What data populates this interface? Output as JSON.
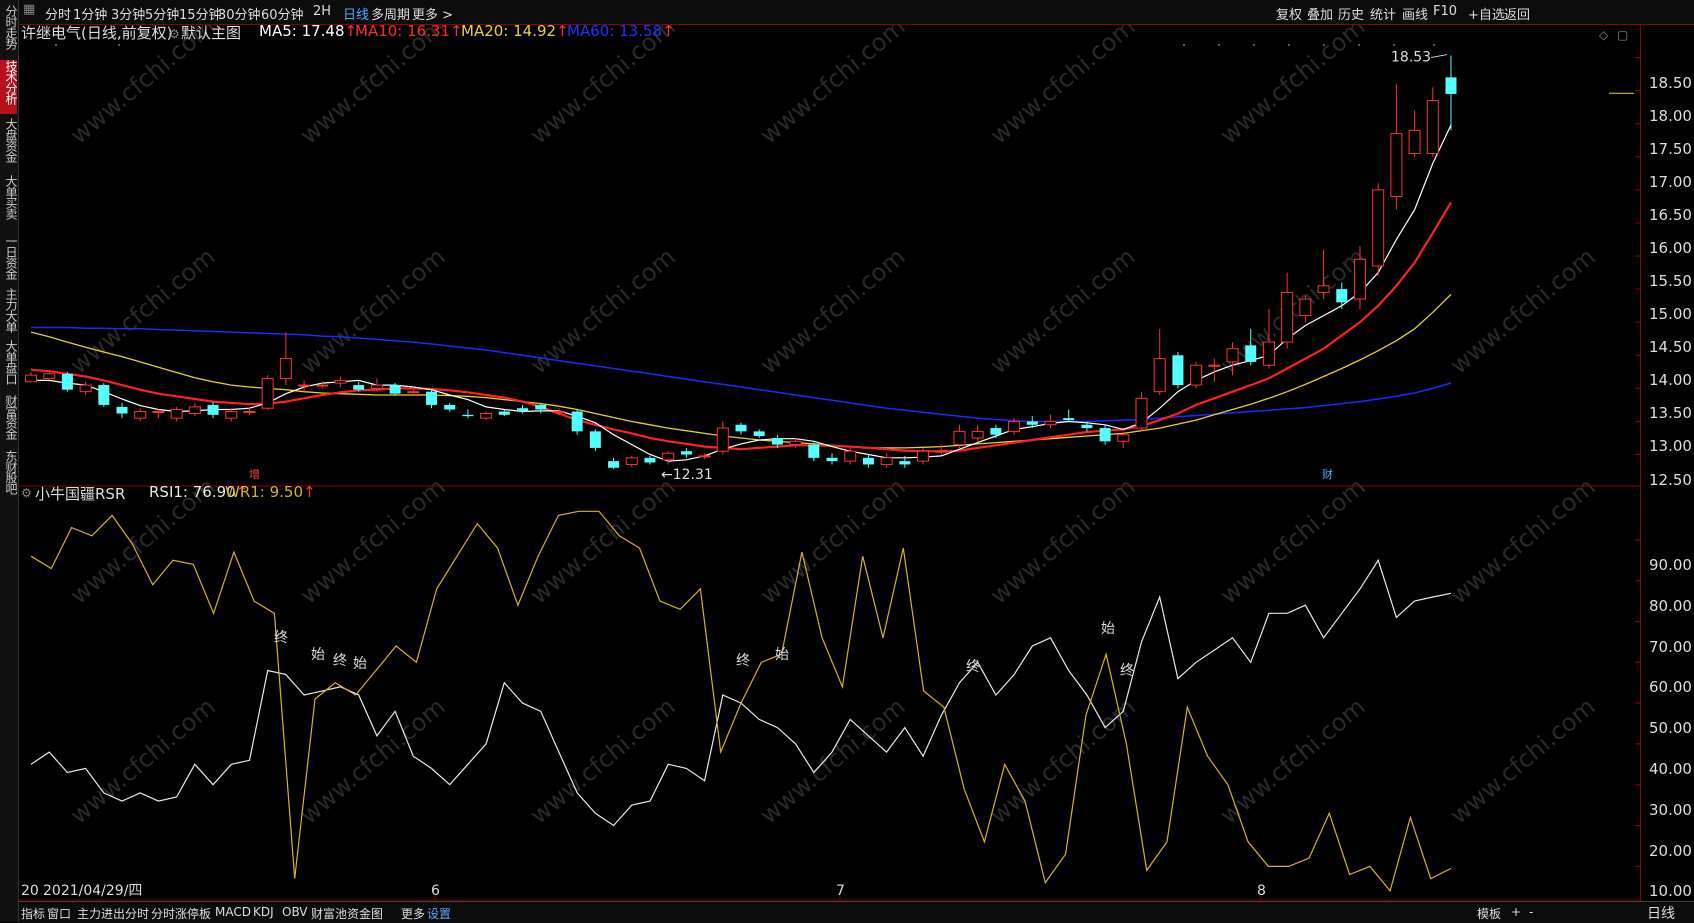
{
  "sidebar": [
    {
      "label": "分时走势",
      "active": false
    },
    {
      "label": "技术分析",
      "active": true
    },
    {
      "label": "大盘资金",
      "active": false
    },
    {
      "label": "大单买卖",
      "active": false
    },
    {
      "label": "一日资金",
      "active": false
    },
    {
      "label": "主力大单",
      "active": false
    },
    {
      "label": "大单盘口",
      "active": false
    },
    {
      "label": "财富资金",
      "active": false
    },
    {
      "label": "东财股吧",
      "active": false
    }
  ],
  "toolbar": {
    "periods": [
      "分时",
      "1分钟",
      "3分钟",
      "5分钟",
      "15分钟",
      "30分钟",
      "60分钟",
      "2H",
      "日线",
      "多周期",
      "更多 >"
    ],
    "active_period": "日线",
    "right_tools": [
      "复权",
      "叠加",
      "历史",
      "统计",
      "画线",
      "F10",
      "+自选",
      "返回"
    ]
  },
  "main_chart": {
    "stock_name": "许继电气(日线,前复权)",
    "template": "默认主图",
    "ma": [
      {
        "label": "MA5: 17.48",
        "color": "#ffffff"
      },
      {
        "label": "MA10: 16.31",
        "color": "#ff2a2a"
      },
      {
        "label": "MA20: 14.92",
        "color": "#e8d23a"
      },
      {
        "label": "MA60: 13.58",
        "color": "#1e32ff"
      }
    ],
    "high_mark": "18.53",
    "low_mark": "12.31",
    "y_ticks": [
      "18.50",
      "18.00",
      "17.50",
      "17.00",
      "16.50",
      "16.00",
      "15.50",
      "15.00",
      "14.50",
      "14.00",
      "13.50",
      "13.00",
      "12.50"
    ],
    "markers": [
      "增",
      "财"
    ]
  },
  "indicator": {
    "name": "小牛国疆RSR",
    "rsi": "RSI1: 76.90",
    "wr": "WR1: 9.50",
    "y_ticks": [
      "90.00",
      "80.00",
      "70.00",
      "60.00",
      "50.00",
      "40.00",
      "30.00",
      "20.00",
      "10.00"
    ],
    "labels": [
      "终",
      "始",
      "终",
      "始",
      "终",
      "始",
      "终",
      "始",
      "终"
    ]
  },
  "x_axis": {
    "date_label": "2021/04/29/四",
    "start_stub": "20",
    "months": [
      "6",
      "7",
      "8"
    ],
    "period": "日线"
  },
  "bottom_tabs": [
    "指标",
    "窗口",
    "主力进出分时",
    "分时涨停板",
    "MACD",
    "KDJ",
    "OBV",
    "财富池资金图",
    "更多",
    "设置"
  ],
  "bottom_right": [
    "模板",
    "+",
    "-"
  ],
  "watermark": "www.cfchi.com",
  "colors": {
    "up": "#ff3030",
    "down": "#54ffff",
    "ma5": "#ffffff",
    "ma10": "#ff2020",
    "ma20": "#e5cf2e",
    "ma60": "#1a2bff",
    "rsi": "#e8e8e8",
    "wr": "#d6b22a",
    "accent": "#5aa8ff"
  },
  "chart_data": [
    {
      "type": "candlestick",
      "title": "许继电气(日线,前复权)",
      "ylim": [
        12.1,
        18.75
      ],
      "candles": [
        [
          13.6,
          13.7,
          13.6,
          13.75
        ],
        [
          13.65,
          13.72,
          13.68,
          13.78
        ],
        [
          13.72,
          13.48,
          13.45,
          13.75
        ],
        [
          13.45,
          13.55,
          13.4,
          13.6
        ],
        [
          13.55,
          13.25,
          13.22,
          13.58
        ],
        [
          13.22,
          13.12,
          13.05,
          13.28
        ],
        [
          13.05,
          13.15,
          13.0,
          13.2
        ],
        [
          13.15,
          13.15,
          13.05,
          13.18
        ],
        [
          13.05,
          13.18,
          13.0,
          13.22
        ],
        [
          13.12,
          13.22,
          13.08,
          13.28
        ],
        [
          13.25,
          13.1,
          13.05,
          13.3
        ],
        [
          13.05,
          13.15,
          13.0,
          13.2
        ],
        [
          13.15,
          13.15,
          13.1,
          13.22
        ],
        [
          13.2,
          13.65,
          13.18,
          13.7
        ],
        [
          13.65,
          13.95,
          13.55,
          14.35
        ],
        [
          13.55,
          13.55,
          13.45,
          13.62
        ],
        [
          13.55,
          13.55,
          13.5,
          13.6
        ],
        [
          13.58,
          13.62,
          13.52,
          13.68
        ],
        [
          13.55,
          13.48,
          13.45,
          13.6
        ],
        [
          13.5,
          13.55,
          13.45,
          13.65
        ],
        [
          13.55,
          13.42,
          13.4,
          13.58
        ],
        [
          13.45,
          13.45,
          13.42,
          13.52
        ],
        [
          13.45,
          13.25,
          13.2,
          13.48
        ],
        [
          13.25,
          13.18,
          13.15,
          13.28
        ],
        [
          13.1,
          13.08,
          13.05,
          13.18
        ],
        [
          13.05,
          13.12,
          13.02,
          13.15
        ],
        [
          13.15,
          13.1,
          13.08,
          13.18
        ],
        [
          13.2,
          13.15,
          13.12,
          13.25
        ],
        [
          13.25,
          13.18,
          13.12,
          13.28
        ],
        [
          13.15,
          13.15,
          13.1,
          13.2
        ],
        [
          13.15,
          12.85,
          12.8,
          13.18
        ],
        [
          12.85,
          12.6,
          12.55,
          12.88
        ],
        [
          12.4,
          12.3,
          12.28,
          12.45
        ],
        [
          12.35,
          12.45,
          12.31,
          12.48
        ],
        [
          12.45,
          12.38,
          12.35,
          12.48
        ],
        [
          12.42,
          12.52,
          12.35,
          12.55
        ],
        [
          12.55,
          12.5,
          12.45,
          12.6
        ],
        [
          12.48,
          12.48,
          12.43,
          12.52
        ],
        [
          12.55,
          12.9,
          12.5,
          13.0
        ],
        [
          12.95,
          12.85,
          12.8,
          12.98
        ],
        [
          12.85,
          12.78,
          12.75,
          12.88
        ],
        [
          12.75,
          12.65,
          12.6,
          12.8
        ],
        [
          12.65,
          12.7,
          12.6,
          12.75
        ],
        [
          12.65,
          12.45,
          12.4,
          12.68
        ],
        [
          12.45,
          12.4,
          12.35,
          12.52
        ],
        [
          12.4,
          12.55,
          12.35,
          12.6
        ],
        [
          12.45,
          12.35,
          12.3,
          12.5
        ],
        [
          12.35,
          12.45,
          12.3,
          12.52
        ],
        [
          12.4,
          12.35,
          12.3,
          12.48
        ],
        [
          12.4,
          12.55,
          12.35,
          12.6
        ],
        [
          12.55,
          12.55,
          12.5,
          12.65
        ],
        [
          12.65,
          12.85,
          12.6,
          12.95
        ],
        [
          12.75,
          12.85,
          12.7,
          12.95
        ],
        [
          12.9,
          12.8,
          12.75,
          12.95
        ],
        [
          12.85,
          13.0,
          12.8,
          13.05
        ],
        [
          13.0,
          12.95,
          12.9,
          13.08
        ],
        [
          12.95,
          13.0,
          12.9,
          13.1
        ],
        [
          13.05,
          13.02,
          13.0,
          13.18
        ],
        [
          12.95,
          12.9,
          12.85,
          13.0
        ],
        [
          12.9,
          12.7,
          12.65,
          12.95
        ],
        [
          12.7,
          12.8,
          12.6,
          12.85
        ],
        [
          12.9,
          13.35,
          12.85,
          13.45
        ],
        [
          13.45,
          13.95,
          13.4,
          14.4
        ],
        [
          14.0,
          13.55,
          13.5,
          14.05
        ],
        [
          13.55,
          13.85,
          13.5,
          13.9
        ],
        [
          13.85,
          13.85,
          13.6,
          13.95
        ],
        [
          13.9,
          14.1,
          13.7,
          14.2
        ],
        [
          14.15,
          13.9,
          13.85,
          14.4
        ],
        [
          13.85,
          14.2,
          13.8,
          14.7
        ],
        [
          14.2,
          14.95,
          14.1,
          15.25
        ],
        [
          14.6,
          14.85,
          14.5,
          14.9
        ],
        [
          14.95,
          15.05,
          14.85,
          15.6
        ],
        [
          15.0,
          14.8,
          14.7,
          15.1
        ],
        [
          14.85,
          15.45,
          14.7,
          15.65
        ],
        [
          15.35,
          16.5,
          15.2,
          16.6
        ],
        [
          16.4,
          17.35,
          16.2,
          18.1
        ],
        [
          17.05,
          17.4,
          17.0,
          17.7
        ],
        [
          17.05,
          17.85,
          17.0,
          18.05
        ],
        [
          18.2,
          17.95,
          17.4,
          18.53
        ]
      ],
      "ma5": [
        13.62,
        13.62,
        13.58,
        13.55,
        13.45,
        13.34,
        13.24,
        13.18,
        13.15,
        13.16,
        13.18,
        13.18,
        13.2,
        13.28,
        13.42,
        13.52,
        13.58,
        13.6,
        13.62,
        13.55,
        13.55,
        13.52,
        13.48,
        13.4,
        13.33,
        13.22,
        13.18,
        13.15,
        13.16,
        13.16,
        13.08,
        12.98,
        12.8,
        12.65,
        12.5,
        12.4,
        12.42,
        12.48,
        12.58,
        12.66,
        12.72,
        12.74,
        12.74,
        12.7,
        12.62,
        12.55,
        12.5,
        12.45,
        12.45,
        12.46,
        12.48,
        12.58,
        12.68,
        12.78,
        12.88,
        12.92,
        12.97,
        13.0,
        12.98,
        12.95,
        12.88,
        12.98,
        13.2,
        13.45,
        13.62,
        13.75,
        13.85,
        13.92,
        14.0,
        14.25,
        14.45,
        14.6,
        14.75,
        14.95,
        15.25,
        15.75,
        16.2,
        16.9,
        17.48
      ],
      "ma10": [
        13.78,
        13.76,
        13.72,
        13.68,
        13.62,
        13.55,
        13.48,
        13.42,
        13.38,
        13.34,
        13.3,
        13.28,
        13.26,
        13.27,
        13.3,
        13.35,
        13.4,
        13.44,
        13.47,
        13.48,
        13.5,
        13.5,
        13.49,
        13.47,
        13.44,
        13.4,
        13.36,
        13.3,
        13.22,
        13.12,
        13.02,
        12.95,
        12.88,
        12.82,
        12.75,
        12.7,
        12.66,
        12.62,
        12.6,
        12.58,
        12.6,
        12.62,
        12.64,
        12.64,
        12.63,
        12.62,
        12.6,
        12.58,
        12.56,
        12.55,
        12.55,
        12.56,
        12.6,
        12.64,
        12.68,
        12.72,
        12.76,
        12.8,
        12.84,
        12.86,
        12.88,
        12.93,
        13.02,
        13.12,
        13.25,
        13.35,
        13.45,
        13.55,
        13.65,
        13.8,
        13.95,
        14.1,
        14.3,
        14.5,
        14.75,
        15.05,
        15.4,
        15.85,
        16.31
      ],
      "ma20": [
        14.35,
        14.28,
        14.2,
        14.12,
        14.05,
        13.98,
        13.9,
        13.82,
        13.74,
        13.66,
        13.6,
        13.55,
        13.52,
        13.5,
        13.48,
        13.45,
        13.43,
        13.42,
        13.41,
        13.4,
        13.4,
        13.4,
        13.4,
        13.39,
        13.38,
        13.36,
        13.33,
        13.3,
        13.27,
        13.23,
        13.18,
        13.12,
        13.06,
        13.0,
        12.95,
        12.9,
        12.86,
        12.82,
        12.78,
        12.75,
        12.72,
        12.7,
        12.68,
        12.66,
        12.64,
        12.62,
        12.6,
        12.6,
        12.6,
        12.61,
        12.62,
        12.64,
        12.66,
        12.68,
        12.7,
        12.72,
        12.74,
        12.76,
        12.78,
        12.8,
        12.82,
        12.86,
        12.9,
        12.96,
        13.02,
        13.1,
        13.18,
        13.26,
        13.35,
        13.45,
        13.56,
        13.68,
        13.8,
        13.93,
        14.07,
        14.22,
        14.4,
        14.65,
        14.92
      ],
      "ma60": [
        14.42,
        14.42,
        14.42,
        14.41,
        14.41,
        14.4,
        14.4,
        14.39,
        14.38,
        14.37,
        14.36,
        14.35,
        14.34,
        14.33,
        14.32,
        14.31,
        14.29,
        14.28,
        14.26,
        14.24,
        14.22,
        14.2,
        14.17,
        14.14,
        14.11,
        14.08,
        14.04,
        14.0,
        13.96,
        13.92,
        13.88,
        13.84,
        13.8,
        13.76,
        13.72,
        13.68,
        13.64,
        13.6,
        13.56,
        13.52,
        13.48,
        13.44,
        13.4,
        13.36,
        13.32,
        13.28,
        13.24,
        13.2,
        13.17,
        13.14,
        13.11,
        13.08,
        13.05,
        13.03,
        13.01,
        13.0,
        13.0,
        13.0,
        13.0,
        13.01,
        13.02,
        13.03,
        13.05,
        13.07,
        13.09,
        13.11,
        13.13,
        13.15,
        13.17,
        13.19,
        13.21,
        13.24,
        13.27,
        13.3,
        13.34,
        13.38,
        13.43,
        13.5,
        13.58
      ]
    },
    {
      "type": "line",
      "title": "小牛国疆RSR",
      "ylim": [
        2,
        101
      ],
      "series": [
        {
          "name": "RSI1",
          "values": [
            35,
            38,
            33,
            34,
            28,
            26,
            28,
            26,
            27,
            35,
            30,
            35,
            36,
            58,
            57,
            52,
            53,
            54,
            52,
            42,
            48,
            37,
            34,
            30,
            35,
            40,
            55,
            50,
            48,
            38,
            28,
            23,
            20,
            25,
            26,
            35,
            34,
            31,
            52,
            50,
            46,
            44,
            40,
            33,
            38,
            46,
            42,
            38,
            44,
            37,
            47,
            55,
            60,
            52,
            57,
            64,
            66,
            58,
            52,
            44,
            48,
            65,
            76,
            56,
            60,
            63,
            66,
            60,
            72,
            72,
            74,
            66,
            72,
            78,
            85,
            71,
            75,
            76,
            76.9
          ]
        },
        {
          "name": "WR1",
          "values": [
            86,
            83,
            93,
            91,
            96,
            89,
            79,
            85,
            84,
            72,
            87,
            75,
            72,
            7,
            51,
            55,
            52,
            58,
            64,
            60,
            78,
            86,
            94,
            88,
            74,
            86,
            96,
            97,
            97,
            91,
            88,
            75,
            73,
            78,
            38,
            50,
            60,
            62,
            87,
            66,
            54,
            86,
            66,
            88,
            53,
            49,
            29,
            16,
            35,
            26,
            6,
            13,
            47,
            62,
            40,
            9,
            16,
            49,
            37,
            30,
            16,
            10,
            10,
            12,
            23,
            8,
            10,
            4,
            22,
            7,
            9.5
          ]
        }
      ]
    }
  ]
}
